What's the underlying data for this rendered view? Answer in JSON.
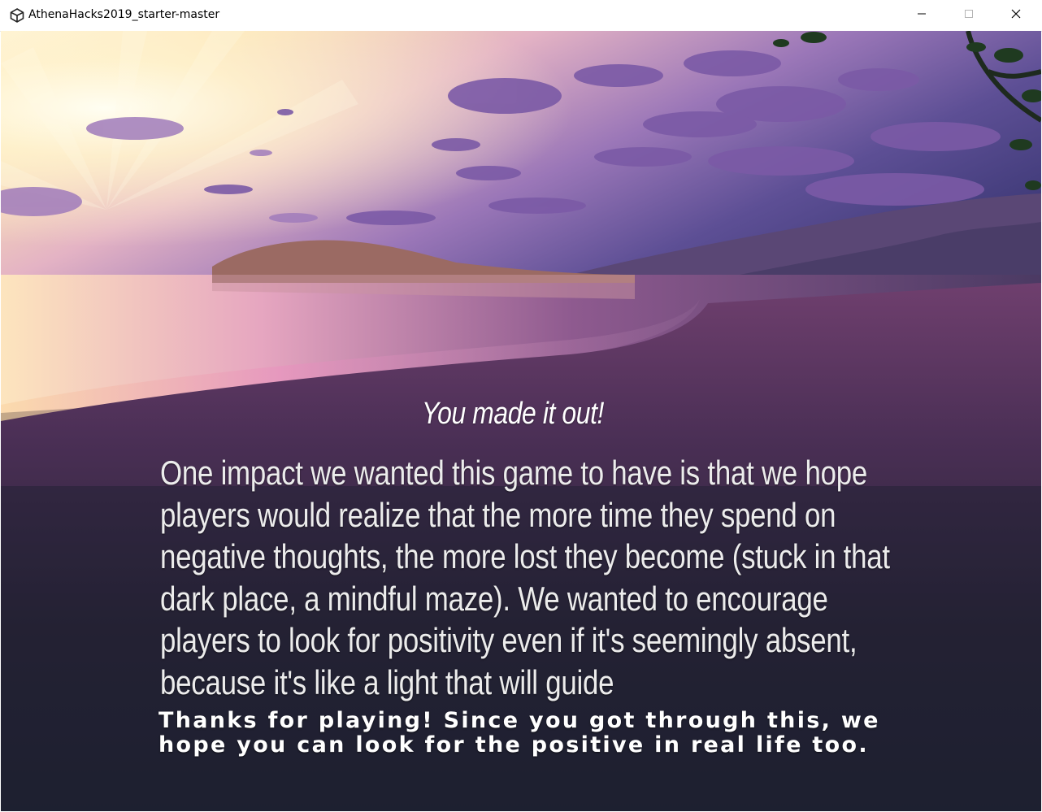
{
  "window": {
    "title": "AthenaHacks2019_starter-master",
    "icon": "unity-icon",
    "controls": [
      "minimize-icon",
      "maximize-icon",
      "close-icon"
    ]
  },
  "game": {
    "heading": "You made it out!",
    "message": "One impact we wanted this game to have is that we hope players would realize that the more time they spend on negative thoughts, the more lost they become (stuck in that dark place, a mindful maze). We wanted to encourage players to look for positivity even if it's seemingly absent, because it's like a light that will guide",
    "thanks": "Thanks for playing! Since you got through this, we hope you can look for the positive in real life too."
  }
}
